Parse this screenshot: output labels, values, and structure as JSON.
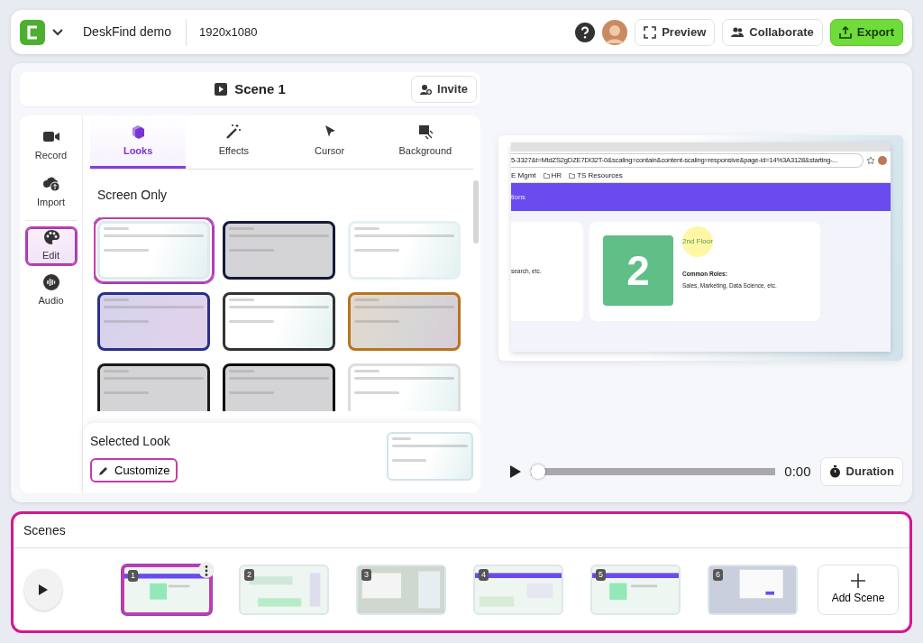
{
  "topbar": {
    "project_name": "DeskFind demo",
    "resolution": "1920x1080",
    "buttons": [
      {
        "label": "Preview",
        "kind": "preview"
      },
      {
        "label": "Collaborate",
        "kind": "collaborate"
      },
      {
        "label": "Export",
        "kind": "export"
      }
    ]
  },
  "scene_header": {
    "title": "Scene 1",
    "invite": "Invite"
  },
  "sidebar": {
    "items": [
      {
        "label": "Record",
        "kind": "record",
        "selected": false
      },
      {
        "label": "Import",
        "kind": "import",
        "selected": false
      },
      {
        "label": "Edit",
        "kind": "edit",
        "selected": true
      },
      {
        "label": "Audio",
        "kind": "audio",
        "selected": false
      }
    ]
  },
  "tabs": [
    {
      "label": "Looks",
      "kind": "looks",
      "selected": true
    },
    {
      "label": "Effects",
      "kind": "effects",
      "selected": false
    },
    {
      "label": "Cursor",
      "kind": "cursor",
      "selected": false
    },
    {
      "label": "Background",
      "kind": "background",
      "selected": false
    }
  ],
  "looks": {
    "section": "Screen Only",
    "items": [
      {
        "color": "#dfe9ee",
        "kind": "light",
        "selected": true
      },
      {
        "color": "#151a3a",
        "kind": "dark",
        "selected": false
      },
      {
        "color": "#e6f0f3",
        "kind": "light",
        "selected": false
      },
      {
        "color": "#2a2f8a",
        "kind": "tinted",
        "selected": false
      },
      {
        "color": "#333333",
        "kind": "light",
        "selected": false
      },
      {
        "color": "#b8741e",
        "kind": "warm",
        "selected": false
      },
      {
        "color": "#1c1c1c",
        "kind": "dark",
        "selected": false
      },
      {
        "color": "#0d0d0d",
        "kind": "dark",
        "selected": false
      },
      {
        "color": "#dddddd",
        "kind": "light",
        "selected": false
      }
    ]
  },
  "selected_look": {
    "title": "Selected Look",
    "button": "Customize"
  },
  "preview": {
    "url": "5-3327&t=MtdZS2gDZE7DI32T-0&scaling=contain&content-scaling=responsive&page-id=14%3A3128&starting-...",
    "bookmarks": [
      "E Mgmt",
      "HR",
      "TS Resources"
    ],
    "banner": "tions",
    "left_card_text": "search, etc.",
    "floor_number": "2",
    "floor_title": "2nd Floor",
    "roles_label": "Common Roles:",
    "roles": "Sales, Marketing, Data Science, etc."
  },
  "player": {
    "level": 0,
    "time": "0:00",
    "duration": "Duration"
  },
  "scenes": {
    "title": "Scenes",
    "add": "Add Scene",
    "items": [
      {
        "number": "1",
        "selected": true
      },
      {
        "number": "2",
        "selected": false
      },
      {
        "number": "3",
        "selected": false
      },
      {
        "number": "4",
        "selected": false
      },
      {
        "number": "5",
        "selected": false
      },
      {
        "number": "6",
        "selected": false
      }
    ]
  }
}
